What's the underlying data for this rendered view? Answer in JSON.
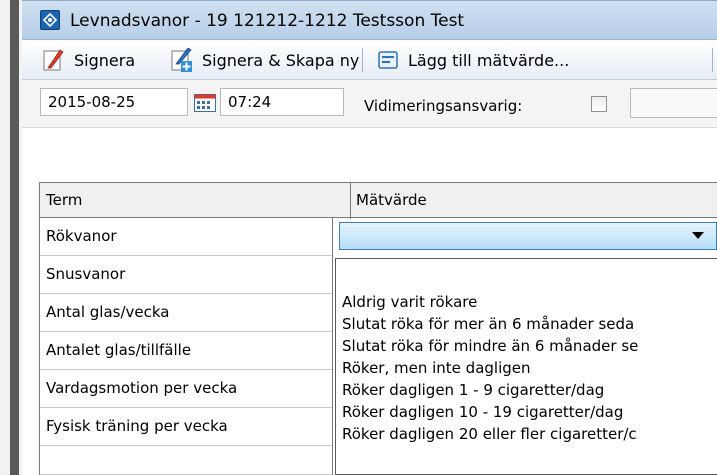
{
  "window": {
    "title": "Levnadsvanor -  19 121212-1212 Testsson Test"
  },
  "toolbar": {
    "sign_label": "Signera",
    "sign_create_label": "Signera & Skapa ny",
    "add_value_label": "Lägg till mätvärde..."
  },
  "datebar": {
    "date": "2015-08-25",
    "time": "07:24",
    "vidimering_label": "Vidimeringsansvarig:"
  },
  "grid": {
    "headers": {
      "term": "Term",
      "value": "Mätvärde"
    },
    "rows": [
      "Rökvanor",
      "Snusvanor",
      "Antal glas/vecka",
      "Antalet glas/tillfälle",
      "Vardagsmotion per vecka",
      "Fysisk träning per vecka"
    ]
  },
  "dropdown": {
    "selected": "",
    "options": [
      "Aldrig varit rökare",
      "Slutat röka för mer än 6 månader seda",
      "Slutat röka för mindre än 6 månader se",
      "Röker, men inte dagligen",
      "Röker dagligen 1 - 9 cigaretter/dag",
      "Röker dagligen 10 - 19 cigaretter/dag",
      "Röker dagligen 20 eller fler cigaretter/c"
    ]
  },
  "colors": {
    "titlebar": "#cfe0f1",
    "dropdown_highlight": "#b7def8",
    "grid_border": "#7a7a7a"
  }
}
